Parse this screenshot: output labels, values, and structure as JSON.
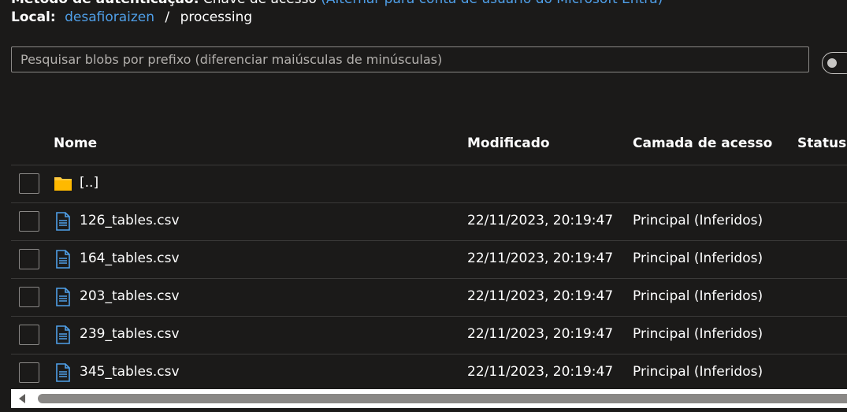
{
  "auth": {
    "label": "Método de autenticação:",
    "value": "Chave de acesso",
    "switch_link": "(Alternar para conta de usuário do Microsoft Entra)"
  },
  "location": {
    "label": "Local:",
    "container": "desafioraizen",
    "separator": "/",
    "folder": "processing"
  },
  "search": {
    "placeholder": "Pesquisar blobs por prefixo (diferenciar maiúsculas de minúsculas)",
    "value": ""
  },
  "grid": {
    "headers": {
      "name": "Nome",
      "modified": "Modificado",
      "tier": "Camada de acesso",
      "status": "Status d"
    },
    "parent_row": {
      "icon": "folder-icon",
      "name": "[..]"
    },
    "rows": [
      {
        "icon": "file-icon",
        "name": "126_tables.csv",
        "modified": "22/11/2023, 20:19:47",
        "tier": "Principal (Inferidos)"
      },
      {
        "icon": "file-icon",
        "name": "164_tables.csv",
        "modified": "22/11/2023, 20:19:47",
        "tier": "Principal (Inferidos)"
      },
      {
        "icon": "file-icon",
        "name": "203_tables.csv",
        "modified": "22/11/2023, 20:19:47",
        "tier": "Principal (Inferidos)"
      },
      {
        "icon": "file-icon",
        "name": "239_tables.csv",
        "modified": "22/11/2023, 20:19:47",
        "tier": "Principal (Inferidos)"
      },
      {
        "icon": "file-icon",
        "name": "345_tables.csv",
        "modified": "22/11/2023, 20:19:47",
        "tier": "Principal (Inferidos)"
      }
    ]
  },
  "colors": {
    "background": "#1b1a19",
    "link": "#4f9fe8",
    "folder": "#ffc83d",
    "file_icon": "#4f9fe8",
    "border": "#3b3a39"
  }
}
